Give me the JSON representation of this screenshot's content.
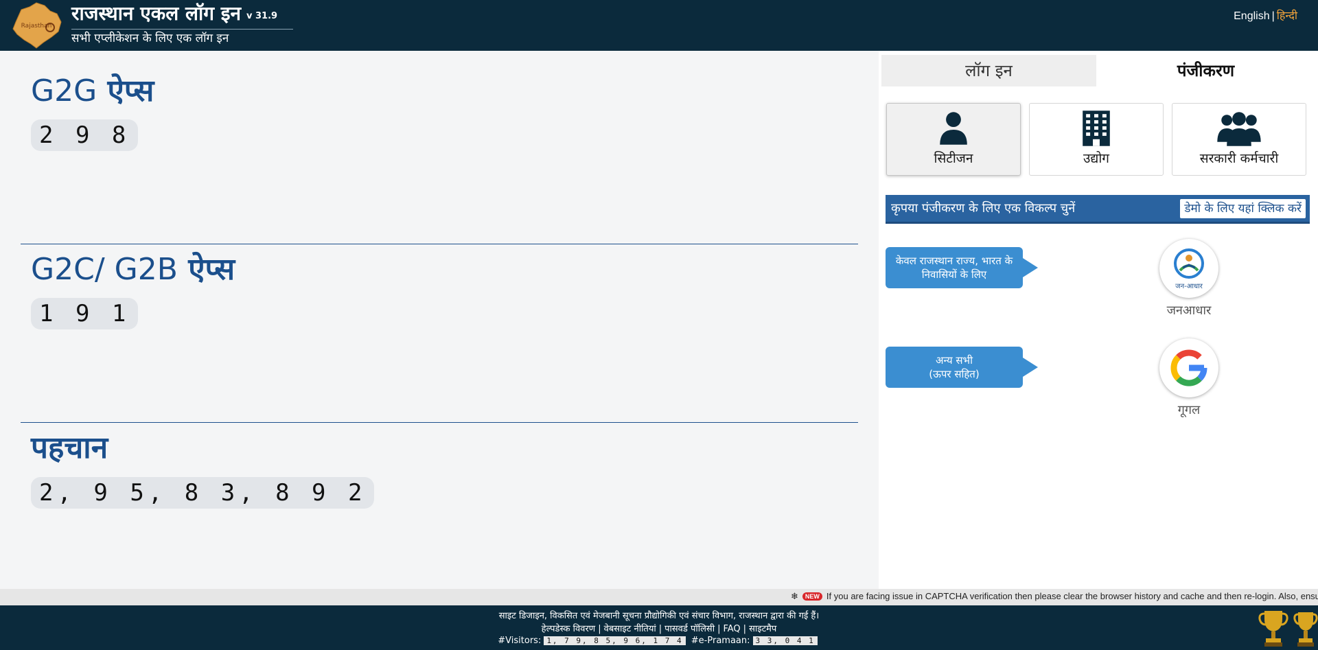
{
  "header": {
    "title": "राजस्थान एकल लॉग इन",
    "version": "v 31.9",
    "subtitle": "सभी एप्लीकेशन के लिए एक लॉग इन",
    "logo_text": "Rajasthan",
    "lang_english": "English",
    "lang_separator": "|",
    "lang_hindi": "हिन्दी"
  },
  "stats": [
    {
      "title_latin": "G2G",
      "title_hindi": "ऐप्स",
      "count": "2 9 8"
    },
    {
      "title_latin": "G2C/ G2B",
      "title_hindi": "ऐप्स",
      "count": "1 9 1"
    },
    {
      "title_latin": "",
      "title_hindi": "पहचान",
      "count": "2, 9 5, 8 3, 8 9 2"
    }
  ],
  "tabs": {
    "login": "लॉग इन",
    "register": "पंजीकरण"
  },
  "user_types": [
    {
      "label": "सिटीजन",
      "icon": "user-icon"
    },
    {
      "label": "उद्योग",
      "icon": "building-icon"
    },
    {
      "label": "सरकारी कर्मचारी",
      "icon": "users-group-icon"
    }
  ],
  "banner": {
    "text": "कृपया पंजीकरण के लिए एक विकल्प चुनें",
    "demo_link": "डेमो के लिए यहां क्लिक करें"
  },
  "options": [
    {
      "bubble_line1": "केवल राजस्थान राज्य, भारत के",
      "bubble_line2": "निवासियों के लिए",
      "provider": "जनआधार",
      "logo_caption": "जन-आधार"
    },
    {
      "bubble_line1": "अन्य सभी",
      "bubble_line2": "(ऊपर सहित)",
      "provider": "गूगल",
      "logo_caption": ""
    }
  ],
  "ticker": {
    "badge": "NEW",
    "text": "If you are facing issue in CAPTCHA verification then please clear the browser history and cache and then re-login. Also, ensure"
  },
  "footer": {
    "credit": "साइट डिजाइन, विकसित एवं मेजबानी सूचना प्रौद्योगिकी एवं संचार विभाग, राजस्थान द्वारा की गई हैं।",
    "links": [
      "हेल्पडेस्क विवरण",
      "वेबसाइट नीतियां",
      "पासवर्ड पॉलिसी",
      "FAQ",
      "साइटमैप"
    ],
    "visitors_label": "#Visitors:",
    "visitors_value": "1, 7 9, 8 5, 9 6, 1 7 4",
    "epramaan_label": "#e-Pramaan:",
    "epramaan_value": "3 3, 0 4 1"
  },
  "colors": {
    "header_bg": "#0b2a3c",
    "stat_title": "#1b4f8c",
    "banner_bg": "#2a63a0",
    "bubble_bg": "#3b8ed1",
    "lang_active": "#f2a33a"
  }
}
